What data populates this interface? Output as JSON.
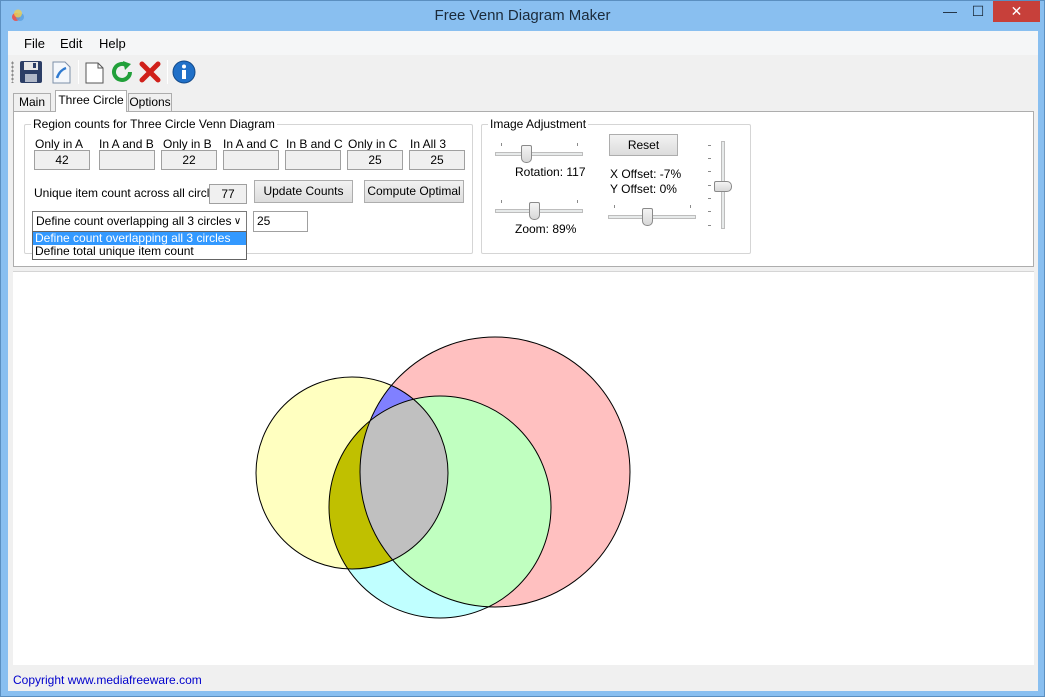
{
  "window": {
    "title": "Free Venn Diagram Maker",
    "minimize_glyph": "—",
    "maximize_glyph": "☐",
    "close_glyph": "✕"
  },
  "menu": {
    "file": "File",
    "edit": "Edit",
    "help": "Help"
  },
  "toolbar_icons": [
    "save-icon",
    "open-icon",
    "new-document-icon",
    "refresh-icon",
    "delete-icon",
    "info-icon"
  ],
  "tabs": {
    "main": "Main",
    "three_circle": "Three Circle",
    "options": "Options",
    "active": "Three Circle"
  },
  "region_counts": {
    "title": "Region counts for Three Circle Venn Diagram",
    "only_a_label": "Only in A",
    "only_a_value": "42",
    "a_b_label": "In A and B",
    "a_b_value": "",
    "only_b_label": "Only in B",
    "only_b_value": "22",
    "a_c_label": "In A and C",
    "a_c_value": "",
    "b_c_label": "In B and C",
    "b_c_value": "",
    "only_c_label": "Only in C",
    "only_c_value": "25",
    "all3_label": "In All 3",
    "all3_value": "25",
    "unique_label": "Unique item count across all circles",
    "unique_value": "77",
    "update_button": "Update Counts",
    "compute_button": "Compute Optimal",
    "combo_selected": "Define count overlapping all 3 circles",
    "combo_arrow": "∨",
    "options": [
      "Define count overlapping all 3 circles",
      "Define total unique item count"
    ],
    "overlap_value": "25"
  },
  "image_adjustment": {
    "title": "Image Adjustment",
    "rotation_label": "Rotation: 117",
    "zoom_label": "Zoom: 89%",
    "reset_button": "Reset",
    "x_offset_label": "X Offset: -7%",
    "y_offset_label": "Y Offset: 0%"
  },
  "colors": {
    "circle_a": "#ffc0c0",
    "circle_b": "#ffffc0",
    "circle_c": "#c0ffff",
    "a_b": "#8080ff",
    "b_c": "#c0c000",
    "a_c": "#c0ffc0",
    "all3": "#c0c0c0"
  },
  "status": {
    "copyright": "Copyright www.mediafreeware.com"
  }
}
